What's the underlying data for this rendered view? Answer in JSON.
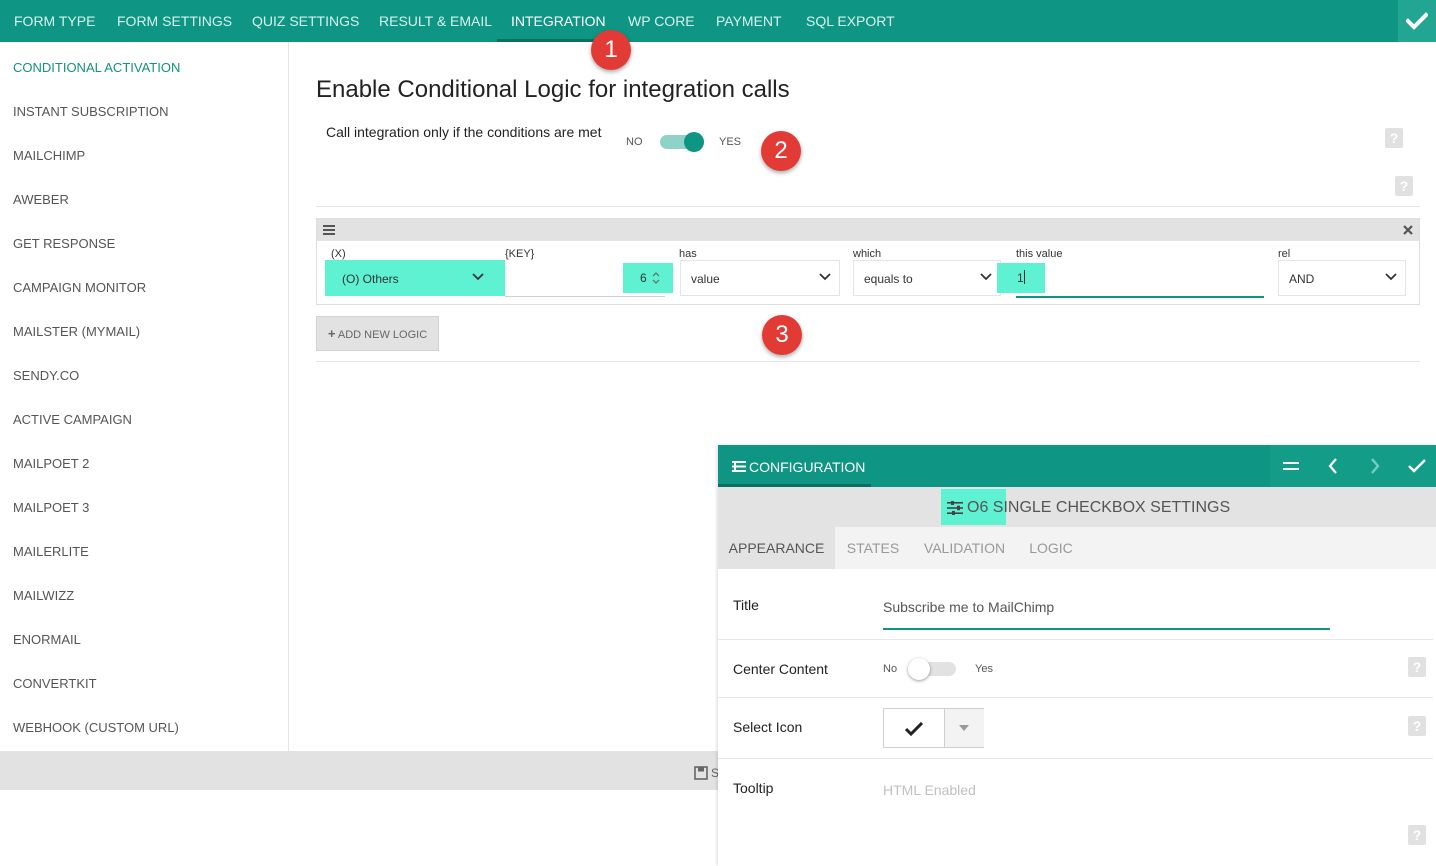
{
  "nav": {
    "tabs": [
      {
        "label": "FORM TYPE"
      },
      {
        "label": "FORM SETTINGS"
      },
      {
        "label": "QUIZ SETTINGS"
      },
      {
        "label": "RESULT & EMAIL"
      },
      {
        "label": "INTEGRATION"
      },
      {
        "label": "WP CORE"
      },
      {
        "label": "PAYMENT"
      },
      {
        "label": "SQL EXPORT"
      }
    ],
    "active_tab": "INTEGRATION"
  },
  "sidebar": {
    "items": [
      {
        "label": "CONDITIONAL ACTIVATION"
      },
      {
        "label": "INSTANT SUBSCRIPTION"
      },
      {
        "label": "MAILCHIMP"
      },
      {
        "label": "AWEBER"
      },
      {
        "label": "GET RESPONSE"
      },
      {
        "label": "CAMPAIGN MONITOR"
      },
      {
        "label": "MAILSTER (MYMAIL)"
      },
      {
        "label": "SENDY.CO"
      },
      {
        "label": "ACTIVE CAMPAIGN"
      },
      {
        "label": "MAILPOET 2"
      },
      {
        "label": "MAILPOET 3"
      },
      {
        "label": "MAILERLITE"
      },
      {
        "label": "MAILWIZZ"
      },
      {
        "label": "ENORMAIL"
      },
      {
        "label": "CONVERTKIT"
      },
      {
        "label": "WEBHOOK (CUSTOM URL)"
      }
    ],
    "active_item": "CONDITIONAL ACTIVATION"
  },
  "main": {
    "heading": "Enable Conditional Logic for integration calls",
    "call_label": "Call integration only if the conditions are met",
    "toggle_no": "NO",
    "toggle_yes": "YES",
    "toggle_on": true,
    "logic": {
      "labels": {
        "x": "(X)",
        "key": "{KEY}",
        "has": "has",
        "which": "which",
        "value": "this value",
        "rel": "rel"
      },
      "x_value": "(O) Others",
      "key_value": "",
      "key_number": "6",
      "has_value": "value",
      "which_value": "equals to",
      "this_value": "1",
      "rel_value": "AND"
    },
    "add_logic_label": "ADD NEW LOGIC"
  },
  "badges": [
    "1",
    "2",
    "3"
  ],
  "bottom": {
    "save_label": "S"
  },
  "config": {
    "title": "CONFIGURATION",
    "subtitle": "O6 SINGLE CHECKBOX SETTINGS",
    "tabs": [
      {
        "label": "APPEARANCE"
      },
      {
        "label": "STATES"
      },
      {
        "label": "VALIDATION"
      },
      {
        "label": "LOGIC"
      }
    ],
    "active_tab": "APPEARANCE",
    "fields": {
      "title_label": "Title",
      "title_value": "Subscribe me to MailChimp",
      "center_label": "Center Content",
      "center_no": "No",
      "center_yes": "Yes",
      "center_on": false,
      "icon_label": "Select Icon",
      "tooltip_label": "Tooltip",
      "tooltip_placeholder": "HTML Enabled"
    }
  },
  "colors": {
    "primary": "#0e9583",
    "highlight": "#5ef2d2",
    "badge": "#e23b36",
    "sidebar_active": "#14917f"
  }
}
